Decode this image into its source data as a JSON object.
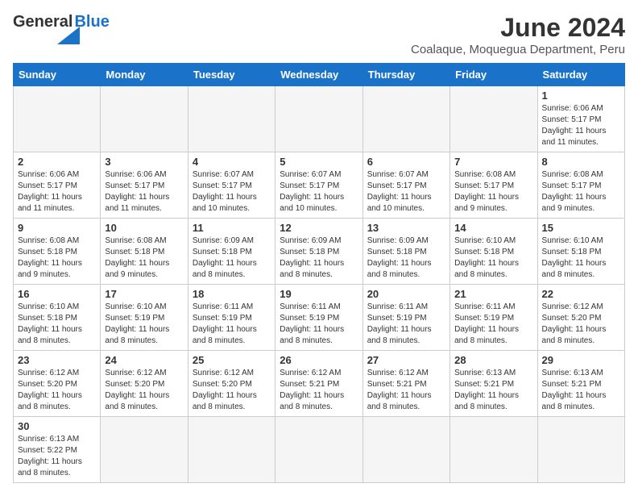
{
  "header": {
    "logo_general": "General",
    "logo_blue": "Blue",
    "title": "June 2024",
    "subtitle": "Coalaque, Moquegua Department, Peru"
  },
  "calendar": {
    "days_of_week": [
      "Sunday",
      "Monday",
      "Tuesday",
      "Wednesday",
      "Thursday",
      "Friday",
      "Saturday"
    ],
    "weeks": [
      {
        "days": [
          {
            "number": "",
            "empty": true
          },
          {
            "number": "",
            "empty": true
          },
          {
            "number": "",
            "empty": true
          },
          {
            "number": "",
            "empty": true
          },
          {
            "number": "",
            "empty": true
          },
          {
            "number": "",
            "empty": true
          },
          {
            "number": "1",
            "sunrise": "Sunrise: 6:06 AM",
            "sunset": "Sunset: 5:17 PM",
            "daylight": "Daylight: 11 hours and 11 minutes."
          }
        ]
      },
      {
        "days": [
          {
            "number": "2",
            "sunrise": "Sunrise: 6:06 AM",
            "sunset": "Sunset: 5:17 PM",
            "daylight": "Daylight: 11 hours and 11 minutes."
          },
          {
            "number": "3",
            "sunrise": "Sunrise: 6:06 AM",
            "sunset": "Sunset: 5:17 PM",
            "daylight": "Daylight: 11 hours and 11 minutes."
          },
          {
            "number": "4",
            "sunrise": "Sunrise: 6:07 AM",
            "sunset": "Sunset: 5:17 PM",
            "daylight": "Daylight: 11 hours and 10 minutes."
          },
          {
            "number": "5",
            "sunrise": "Sunrise: 6:07 AM",
            "sunset": "Sunset: 5:17 PM",
            "daylight": "Daylight: 11 hours and 10 minutes."
          },
          {
            "number": "6",
            "sunrise": "Sunrise: 6:07 AM",
            "sunset": "Sunset: 5:17 PM",
            "daylight": "Daylight: 11 hours and 10 minutes."
          },
          {
            "number": "7",
            "sunrise": "Sunrise: 6:08 AM",
            "sunset": "Sunset: 5:17 PM",
            "daylight": "Daylight: 11 hours and 9 minutes."
          },
          {
            "number": "8",
            "sunrise": "Sunrise: 6:08 AM",
            "sunset": "Sunset: 5:17 PM",
            "daylight": "Daylight: 11 hours and 9 minutes."
          }
        ]
      },
      {
        "days": [
          {
            "number": "9",
            "sunrise": "Sunrise: 6:08 AM",
            "sunset": "Sunset: 5:18 PM",
            "daylight": "Daylight: 11 hours and 9 minutes."
          },
          {
            "number": "10",
            "sunrise": "Sunrise: 6:08 AM",
            "sunset": "Sunset: 5:18 PM",
            "daylight": "Daylight: 11 hours and 9 minutes."
          },
          {
            "number": "11",
            "sunrise": "Sunrise: 6:09 AM",
            "sunset": "Sunset: 5:18 PM",
            "daylight": "Daylight: 11 hours and 8 minutes."
          },
          {
            "number": "12",
            "sunrise": "Sunrise: 6:09 AM",
            "sunset": "Sunset: 5:18 PM",
            "daylight": "Daylight: 11 hours and 8 minutes."
          },
          {
            "number": "13",
            "sunrise": "Sunrise: 6:09 AM",
            "sunset": "Sunset: 5:18 PM",
            "daylight": "Daylight: 11 hours and 8 minutes."
          },
          {
            "number": "14",
            "sunrise": "Sunrise: 6:10 AM",
            "sunset": "Sunset: 5:18 PM",
            "daylight": "Daylight: 11 hours and 8 minutes."
          },
          {
            "number": "15",
            "sunrise": "Sunrise: 6:10 AM",
            "sunset": "Sunset: 5:18 PM",
            "daylight": "Daylight: 11 hours and 8 minutes."
          }
        ]
      },
      {
        "days": [
          {
            "number": "16",
            "sunrise": "Sunrise: 6:10 AM",
            "sunset": "Sunset: 5:18 PM",
            "daylight": "Daylight: 11 hours and 8 minutes."
          },
          {
            "number": "17",
            "sunrise": "Sunrise: 6:10 AM",
            "sunset": "Sunset: 5:19 PM",
            "daylight": "Daylight: 11 hours and 8 minutes."
          },
          {
            "number": "18",
            "sunrise": "Sunrise: 6:11 AM",
            "sunset": "Sunset: 5:19 PM",
            "daylight": "Daylight: 11 hours and 8 minutes."
          },
          {
            "number": "19",
            "sunrise": "Sunrise: 6:11 AM",
            "sunset": "Sunset: 5:19 PM",
            "daylight": "Daylight: 11 hours and 8 minutes."
          },
          {
            "number": "20",
            "sunrise": "Sunrise: 6:11 AM",
            "sunset": "Sunset: 5:19 PM",
            "daylight": "Daylight: 11 hours and 8 minutes."
          },
          {
            "number": "21",
            "sunrise": "Sunrise: 6:11 AM",
            "sunset": "Sunset: 5:19 PM",
            "daylight": "Daylight: 11 hours and 8 minutes."
          },
          {
            "number": "22",
            "sunrise": "Sunrise: 6:12 AM",
            "sunset": "Sunset: 5:20 PM",
            "daylight": "Daylight: 11 hours and 8 minutes."
          }
        ]
      },
      {
        "days": [
          {
            "number": "23",
            "sunrise": "Sunrise: 6:12 AM",
            "sunset": "Sunset: 5:20 PM",
            "daylight": "Daylight: 11 hours and 8 minutes."
          },
          {
            "number": "24",
            "sunrise": "Sunrise: 6:12 AM",
            "sunset": "Sunset: 5:20 PM",
            "daylight": "Daylight: 11 hours and 8 minutes."
          },
          {
            "number": "25",
            "sunrise": "Sunrise: 6:12 AM",
            "sunset": "Sunset: 5:20 PM",
            "daylight": "Daylight: 11 hours and 8 minutes."
          },
          {
            "number": "26",
            "sunrise": "Sunrise: 6:12 AM",
            "sunset": "Sunset: 5:21 PM",
            "daylight": "Daylight: 11 hours and 8 minutes."
          },
          {
            "number": "27",
            "sunrise": "Sunrise: 6:12 AM",
            "sunset": "Sunset: 5:21 PM",
            "daylight": "Daylight: 11 hours and 8 minutes."
          },
          {
            "number": "28",
            "sunrise": "Sunrise: 6:13 AM",
            "sunset": "Sunset: 5:21 PM",
            "daylight": "Daylight: 11 hours and 8 minutes."
          },
          {
            "number": "29",
            "sunrise": "Sunrise: 6:13 AM",
            "sunset": "Sunset: 5:21 PM",
            "daylight": "Daylight: 11 hours and 8 minutes."
          }
        ]
      },
      {
        "days": [
          {
            "number": "30",
            "sunrise": "Sunrise: 6:13 AM",
            "sunset": "Sunset: 5:22 PM",
            "daylight": "Daylight: 11 hours and 8 minutes."
          },
          {
            "number": "",
            "empty": true
          },
          {
            "number": "",
            "empty": true
          },
          {
            "number": "",
            "empty": true
          },
          {
            "number": "",
            "empty": true
          },
          {
            "number": "",
            "empty": true
          },
          {
            "number": "",
            "empty": true
          }
        ]
      }
    ]
  }
}
